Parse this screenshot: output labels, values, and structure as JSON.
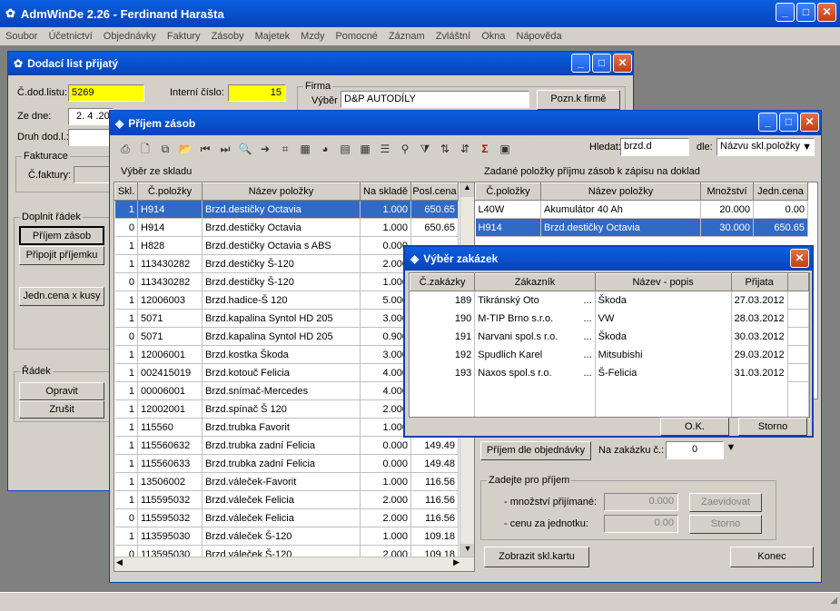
{
  "app": {
    "title": "AdmWinDe 2.26 - Ferdinand Harašta"
  },
  "menu": [
    "Soubor",
    "Účetnictví",
    "Objednávky",
    "Faktury",
    "Zásoby",
    "Majetek",
    "Mzdy",
    "Pomocné",
    "Záznam",
    "Zvláštní",
    "Okna",
    "Nápověda"
  ],
  "dodaci": {
    "title": "Dodací list přijatý",
    "cdod_label": "Č.dod.listu:",
    "cdod_value": "5269",
    "interni_label": "Interní číslo:",
    "interni_value": "15",
    "firma_label": "Firma",
    "vyber_label": "Výběr",
    "vyber_value": "D&P AUTODÍLY",
    "pozn_btn": "Pozn.k firmě",
    "zedne_label": "Ze dne:",
    "zedne_value": "2. 4 .20",
    "druh_label": "Druh dod.l.:",
    "fakturace_label": "Fakturace",
    "cfaktury_label": "Č.faktury:",
    "doplnit_label": "Doplnit řádek",
    "prijem_btn": "Příjem zásob",
    "pripojit_btn": "Připojit příjemku",
    "jedn_btn": "Jedn.cena x kusy",
    "radek_label": "Řádek",
    "opravit_btn": "Opravit",
    "zrusit_btn": "Zrušit"
  },
  "prijem": {
    "title": "Příjem zásob",
    "hledat_label": "Hledat:",
    "hledat_value": "brzd.d",
    "dle_label": "dle:",
    "dle_value": "Názvu skl.položky",
    "sklad_label": "Výběr ze skladu",
    "sklad_headers": [
      "Skl.",
      "Č.položky",
      "Název položky",
      "Na skladě",
      "Posl.cena"
    ],
    "sklad_rows": [
      [
        "1",
        "H914",
        "Brzd.destičky Octavia",
        "1.000",
        "650.65"
      ],
      [
        "0",
        "H914",
        "Brzd.destičky Octavia",
        "1.000",
        "650.65"
      ],
      [
        "1",
        "H828",
        "Brzd.destičky Octavia s ABS",
        "0.000",
        "",
        ""
      ],
      [
        "1",
        "113430282",
        "Brzd.destičky Š-120",
        "2.000",
        ""
      ],
      [
        "0",
        "113430282",
        "Brzd.destičky Š-120",
        "1.000",
        ""
      ],
      [
        "1",
        "12006003",
        "Brzd.hadice-Š 120",
        "5.000",
        ""
      ],
      [
        "1",
        "5071",
        "Brzd.kapalina Syntol HD 205",
        "3.000",
        ""
      ],
      [
        "0",
        "5071",
        "Brzd.kapalina Syntol HD 205",
        "0.900",
        ""
      ],
      [
        "1",
        "12006001",
        "Brzd.kostka Škoda",
        "3.000",
        ""
      ],
      [
        "1",
        "002415019",
        "Brzd.kotouč Felicia",
        "4.000",
        ""
      ],
      [
        "1",
        "00006001",
        "Brzd.snímač-Mercedes",
        "4.000",
        ""
      ],
      [
        "1",
        "12002001",
        "Brzd.spínač Š 120",
        "2.000",
        ""
      ],
      [
        "1",
        "115560",
        "Brzd.trubka Favorit",
        "1.000",
        ""
      ],
      [
        "1",
        "115560632",
        "Brzd.trubka zadní Felicia",
        "0.000",
        "149.49"
      ],
      [
        "1",
        "115560633",
        "Brzd.trubka zadní Felicia",
        "0.000",
        "149.48"
      ],
      [
        "1",
        "13506002",
        "Brzd.váleček-Favorit",
        "1.000",
        "116.56"
      ],
      [
        "1",
        "115595032",
        "Brzd.váleček Felicia",
        "2.000",
        "116.56"
      ],
      [
        "0",
        "115595032",
        "Brzd.váleček Felicia",
        "2.000",
        "116.56"
      ],
      [
        "1",
        "113595030",
        "Brzd.váleček Š-120",
        "1.000",
        "109.18"
      ],
      [
        "0",
        "113595030",
        "Brzd.váleček Š-120",
        "2.000",
        "109.18"
      ]
    ],
    "zadane_label": "Zadané položky příjmu zásob k zápisu na doklad",
    "zadane_headers": [
      "Č.položky",
      "Název položky",
      "Množství",
      "Jedn.cena"
    ],
    "zadane_rows": [
      [
        "L40W",
        "Akumulátor 40 Ah",
        "20.000",
        "0.00"
      ],
      [
        "H914",
        "Brzd.destičky Octavia",
        "30.000",
        "650.65"
      ]
    ],
    "prijem_obj_btn": "Příjem dle objednávky",
    "na_zakazku_label": "Na zakázku č.:",
    "na_zakazku_value": "0",
    "zadejte_label": "Zadejte pro příjem",
    "mnozstvi_label": "- množství přijímané:",
    "mnozstvi_value": "0.000",
    "cena_label": "- cenu za jednotku:",
    "cena_value": "0.00",
    "zaevidovat_btn": "Zaevidovat",
    "storno_btn": "Storno",
    "zobrazit_btn": "Zobrazit skl.kartu",
    "konec_btn": "Konec"
  },
  "zakazky": {
    "title": "Výběr zakázek",
    "headers": [
      "Č.zakázky",
      "Zákazník",
      "Název - popis",
      "Přijata"
    ],
    "rows": [
      [
        "189",
        "Tikránský Oto",
        "...",
        "Škoda",
        "27.03.2012"
      ],
      [
        "190",
        "M-TIP Brno s.r.o.",
        "...",
        "VW",
        "28.03.2012"
      ],
      [
        "191",
        "Narvani spol.s r.o.",
        "...",
        "Škoda",
        "30.03.2012"
      ],
      [
        "192",
        "Spudlich Karel",
        "...",
        "Mitsubishi",
        "29.03.2012"
      ],
      [
        "193",
        "Naxos spol.s r.o.",
        "...",
        "Š-Felicia",
        "31.03.2012"
      ]
    ],
    "ok_btn": "O.K.",
    "storno_btn": "Storno"
  }
}
